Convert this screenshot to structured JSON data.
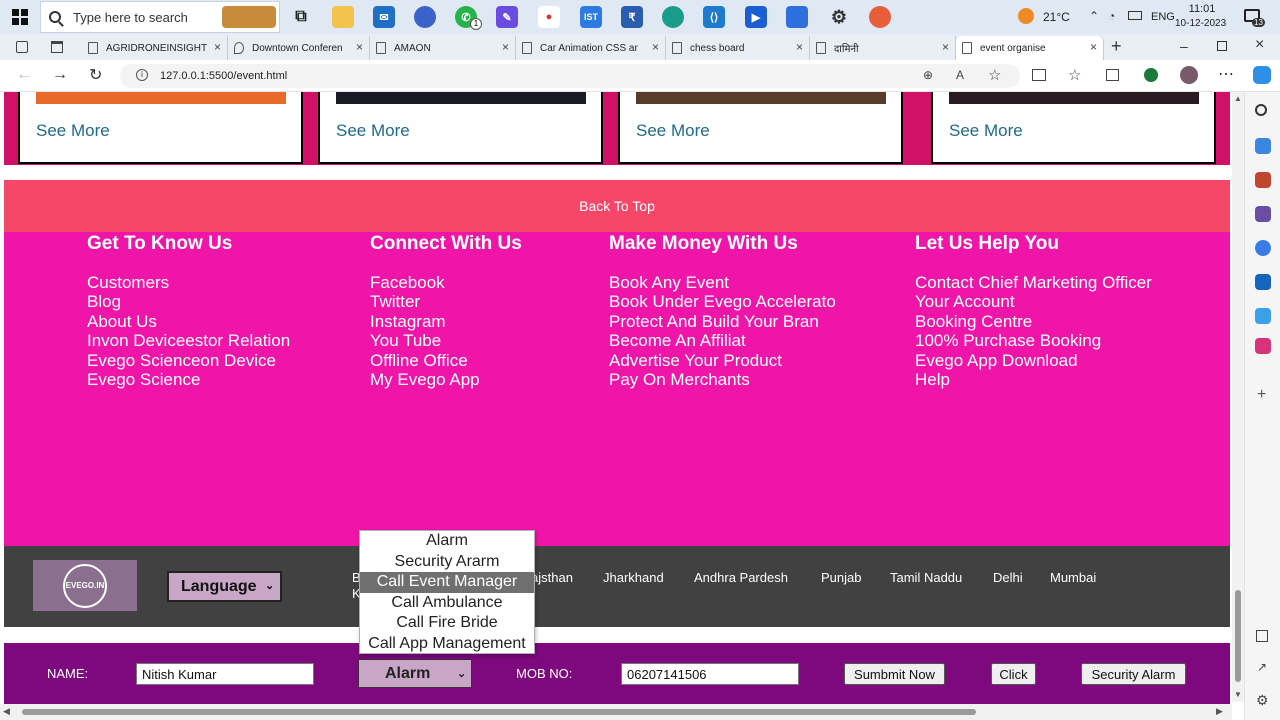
{
  "taskbar": {
    "search_placeholder": "Type here to search",
    "weather": "21°C",
    "language": "ENG",
    "time": "11:01",
    "date": "10-12-2023",
    "notifications": "13",
    "whatsapp_badge": "1"
  },
  "tabs": [
    {
      "label": "AGRIDRONEINSIGHT"
    },
    {
      "label": "Downtown Conferen"
    },
    {
      "label": "AMAON"
    },
    {
      "label": "Car Animation CSS ar"
    },
    {
      "label": "chess board"
    },
    {
      "label": "दामिनी"
    },
    {
      "label": "event organise"
    }
  ],
  "address": {
    "url": "127.0.0.1:5500/event.html"
  },
  "cards": [
    {
      "link": "See More"
    },
    {
      "link": "See More"
    },
    {
      "link": "See More"
    },
    {
      "link": "See More"
    }
  ],
  "back_to_top": "Back To Top",
  "footer": {
    "columns": [
      {
        "title": "Get To Know Us",
        "items": [
          "Customers",
          "Blog",
          "About Us",
          "Invon Deviceestor Relation",
          "Evego Scienceon Device",
          "Evego Science"
        ]
      },
      {
        "title": "Connect With Us",
        "items": [
          "Facebook",
          "Twitter",
          "Instagram",
          "You Tube",
          "Offline Office",
          "My Evego App"
        ]
      },
      {
        "title": "Make Money With Us",
        "items": [
          "Book Any Event",
          "Book Under Evego Accelerato",
          "Protect And Build Your Bran",
          "Become An Affiliat",
          "Advertise Your Product",
          "Pay On Merchants"
        ]
      },
      {
        "title": "Let Us Help You",
        "items": [
          "Contact Chief Marketing Officer",
          "Your Account",
          "Booking Centre",
          "100% Purchase Booking",
          "Evego App Download",
          "Help"
        ]
      }
    ]
  },
  "dark_band": {
    "logo_text": "EVEGO.IN",
    "language_select": "Language",
    "states_partial": [
      "B",
      "K",
      "ajsthan"
    ],
    "states": [
      "Jharkhand",
      "Andhra Pardesh",
      "Punjab",
      "Tamil Naddu",
      "Delhi",
      "Mumbai"
    ]
  },
  "form": {
    "name_label": "NAME:",
    "name_value": "Nitish Kumar",
    "alarm_selected": "Alarm",
    "mob_label": "MOB NO:",
    "mob_value": "06207141506",
    "submit_label": "Sumbmit Now",
    "click_label": "Click",
    "security_label": "Security Alarm"
  },
  "dropdown": {
    "options": [
      "Alarm",
      "Security Ararm",
      "Call Event Manager",
      "Call Ambulance",
      "Call Fire Bride",
      "Call App Management"
    ],
    "highlighted": "Call Event Manager"
  },
  "colors": {
    "cards_bg": "#d11167",
    "back_to_top_bg": "#f64768",
    "footer_bg": "#ef15a8",
    "dark_band_bg": "#414141",
    "form_bg": "#7e087e"
  }
}
